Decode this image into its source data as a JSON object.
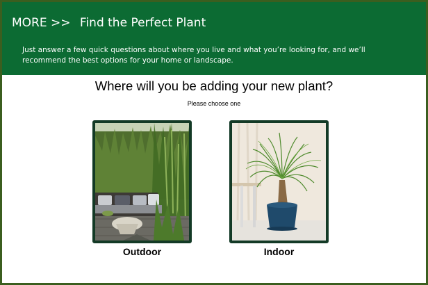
{
  "header": {
    "more": "MORE >>",
    "title": "Find the Perfect Plant",
    "description": "Just answer a few quick questions about where you live and what you’re looking for, and we’ll recommend the best options for your home or landscape."
  },
  "question": "Where will you be adding your new plant?",
  "subtitle": "Please choose one",
  "options": [
    {
      "label": "Outdoor"
    },
    {
      "label": "Indoor"
    }
  ],
  "colors": {
    "header": "#0c6b33",
    "frame": "#3b5e1f",
    "card_border": "#133a26"
  }
}
